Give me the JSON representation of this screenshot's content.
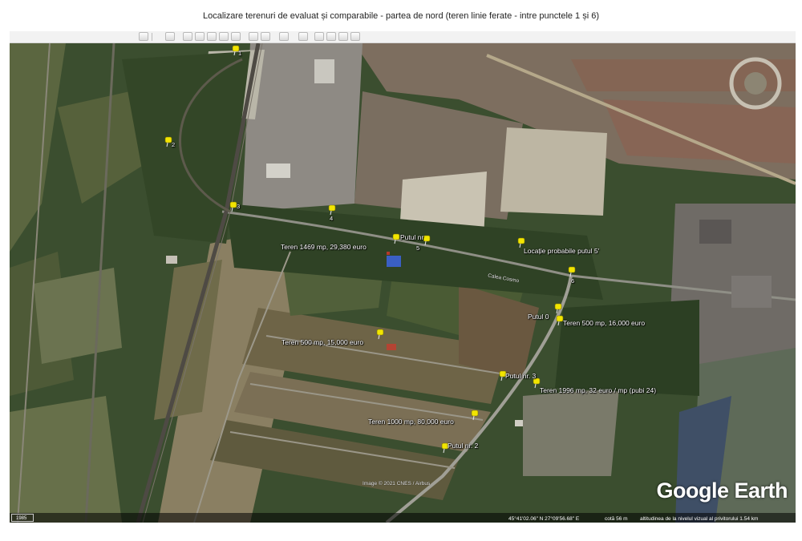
{
  "title": "Localizare terenuri de evaluat și comparabile - partea de nord (teren linie ferate - intre punctele 1 și 6)",
  "toolbar": {
    "buttons": [
      "search-icon",
      "layers-icon",
      "pin-icon",
      "polygon-icon",
      "path-icon",
      "overlay-icon",
      "tour-icon",
      "history-icon",
      "sun-icon",
      "planets-icon",
      "ruler-icon",
      "email-icon",
      "print-icon",
      "save-image-icon",
      "maps-icon"
    ]
  },
  "map": {
    "pins": [
      {
        "id": "pin-top",
        "label": "1"
      },
      {
        "id": "pin-2",
        "label": "2"
      },
      {
        "id": "pin-3",
        "label": "3"
      },
      {
        "id": "pin-4",
        "label": "4"
      },
      {
        "id": "pin-5",
        "label": "5"
      },
      {
        "id": "pin-6",
        "label": "6"
      }
    ],
    "labels": {
      "teren_1469": "Teren 1469 mp, 29,380 euro",
      "putul_nr": "Putul nr",
      "locatie_probabila": "Locație probabile putul 5'",
      "putul_0": "Putul 0",
      "teren_500_16000": "Teren 500 mp, 16,000 euro",
      "teren_500_15000": "Teren 500 mp, 15,000 euro",
      "putul_nr_3": "Putul nr. 3",
      "teren_1996": "Teren 1996 mp, 32 euro / mp (pubi 24)",
      "teren_1000": "Teren 1000 mp, 80,000 euro",
      "putul_nr_2": "Putul nr. 2",
      "road": "Calea Cosmo"
    },
    "credit": "Image © 2021 CNES / Airbus",
    "brand": "Google Earth",
    "status": {
      "year": "1985",
      "coords": "45°41'02.06\" N   27°09'56.68\" E",
      "elevation": "cotă   56 m",
      "eye_alt": "altitudinea de la nivelul vizual al privitorului  1.54 km"
    }
  }
}
